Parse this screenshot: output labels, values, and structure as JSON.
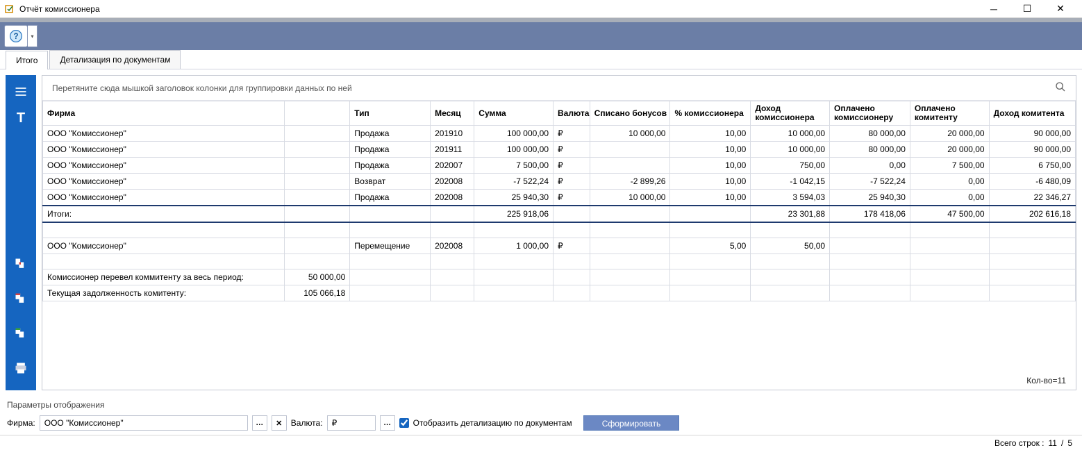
{
  "window": {
    "title": "Отчёт комиссионера"
  },
  "tabs": {
    "t0": "Итого",
    "t1": "Детализация по документам"
  },
  "group_hint": "Перетяните сюда мышкой заголовок колонки для группировки данных по ней",
  "columns": {
    "firm": "Фирма",
    "type": "Тип",
    "month": "Месяц",
    "sum": "Сумма",
    "currency": "Валюта",
    "bonus": "Списано бонусов",
    "pct": "% комиссионера",
    "income_com": "Доход комиссионера",
    "paid_com": "Оплачено комиссионеру",
    "paid_kom": "Оплачено комитенту",
    "income_kom": "Доход комитента"
  },
  "rows": [
    {
      "firm": "ООО \"Комиссионер\"",
      "type": "Продажа",
      "month": "201910",
      "sum": "100 000,00",
      "cur": "₽",
      "bonus": "10 000,00",
      "pct": "10,00",
      "inc": "10 000,00",
      "p1": "80 000,00",
      "p2": "20 000,00",
      "i2": "90 000,00"
    },
    {
      "firm": "ООО \"Комиссионер\"",
      "type": "Продажа",
      "month": "201911",
      "sum": "100 000,00",
      "cur": "₽",
      "bonus": "",
      "pct": "10,00",
      "inc": "10 000,00",
      "p1": "80 000,00",
      "p2": "20 000,00",
      "i2": "90 000,00"
    },
    {
      "firm": "ООО \"Комиссионер\"",
      "type": "Продажа",
      "month": "202007",
      "sum": "7 500,00",
      "cur": "₽",
      "bonus": "",
      "pct": "10,00",
      "inc": "750,00",
      "p1": "0,00",
      "p2": "7 500,00",
      "i2": "6 750,00"
    },
    {
      "firm": "ООО \"Комиссионер\"",
      "type": "Возврат",
      "month": "202008",
      "sum": "-7 522,24",
      "cur": "₽",
      "bonus": "-2 899,26",
      "pct": "10,00",
      "inc": "-1 042,15",
      "p1": "-7 522,24",
      "p2": "0,00",
      "i2": "-6 480,09"
    },
    {
      "firm": "ООО \"Комиссионер\"",
      "type": "Продажа",
      "month": "202008",
      "sum": "25 940,30",
      "cur": "₽",
      "bonus": "10 000,00",
      "pct": "10,00",
      "inc": "3 594,03",
      "p1": "25 940,30",
      "p2": "0,00",
      "i2": "22 346,27"
    }
  ],
  "totals": {
    "label": "Итоги:",
    "sum": "225 918,06",
    "inc": "23 301,88",
    "p1": "178 418,06",
    "p2": "47 500,00",
    "i2": "202 616,18"
  },
  "move_row": {
    "firm": "ООО \"Комиссионер\"",
    "type": "Перемещение",
    "month": "202008",
    "sum": "1 000,00",
    "cur": "₽",
    "pct": "5,00",
    "inc": "50,00"
  },
  "summary": [
    {
      "label": "Комиссионер перевел коммитенту за весь период:",
      "val": "50 000,00"
    },
    {
      "label": "Текущая задолженность комитенту:",
      "val": "105 066,18"
    }
  ],
  "row_count_label": "Кол-во=11",
  "params": {
    "section": "Параметры отображения",
    "firm_label": "Фирма:",
    "firm_value": "ООО \"Комиссионер\"",
    "currency_label": "Валюта:",
    "currency_value": "₽",
    "detail_label": "Отобразить детализацию по документам",
    "submit": "Сформировать"
  },
  "status": {
    "label": "Всего строк :",
    "a": "11",
    "sep": "/",
    "b": "5"
  }
}
